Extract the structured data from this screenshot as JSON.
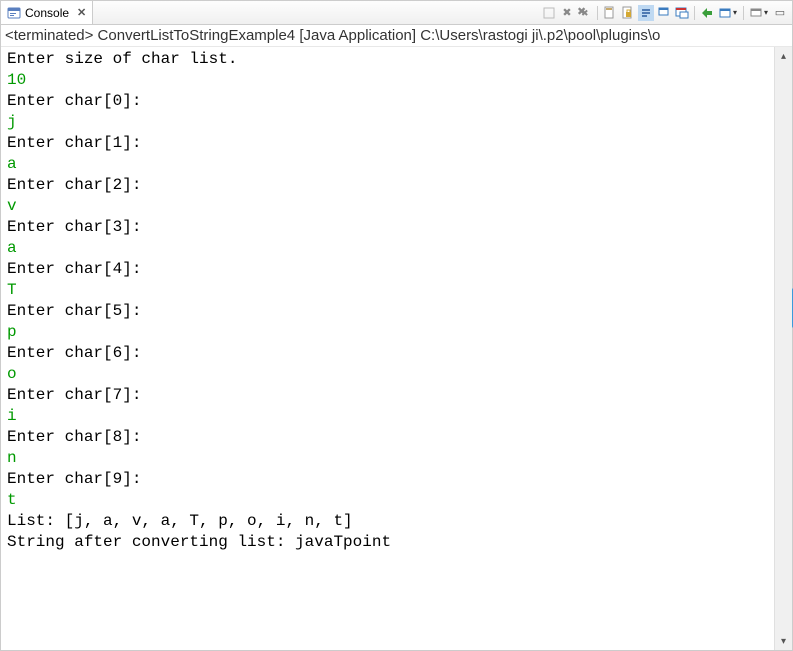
{
  "tab": {
    "title": "Console",
    "close_glyph": "✕"
  },
  "toolbar": {
    "blank": "",
    "x_gray": "✖",
    "xx_gray": "✖",
    "doc": "",
    "lock": "",
    "scroll": "",
    "word": "",
    "page": "",
    "green_right": "",
    "console2": "",
    "dash": "—",
    "pin": "",
    "menu": "▾",
    "max": "▭"
  },
  "status": {
    "text": "<terminated> ConvertListToStringExample4 [Java Application] C:\\Users\\rastogi ji\\.p2\\pool\\plugins\\o"
  },
  "console": {
    "lines": [
      {
        "cls": "out",
        "text": "Enter size of char list."
      },
      {
        "cls": "inp",
        "text": "10"
      },
      {
        "cls": "out",
        "text": "Enter char[0]:"
      },
      {
        "cls": "inp",
        "text": "j"
      },
      {
        "cls": "out",
        "text": "Enter char[1]:"
      },
      {
        "cls": "inp",
        "text": "a"
      },
      {
        "cls": "out",
        "text": "Enter char[2]:"
      },
      {
        "cls": "inp",
        "text": "v"
      },
      {
        "cls": "out",
        "text": "Enter char[3]:"
      },
      {
        "cls": "inp",
        "text": "a"
      },
      {
        "cls": "out",
        "text": "Enter char[4]:"
      },
      {
        "cls": "inp",
        "text": "T"
      },
      {
        "cls": "out",
        "text": "Enter char[5]:"
      },
      {
        "cls": "inp",
        "text": "p"
      },
      {
        "cls": "out",
        "text": "Enter char[6]:"
      },
      {
        "cls": "inp",
        "text": "o"
      },
      {
        "cls": "out",
        "text": "Enter char[7]:"
      },
      {
        "cls": "inp",
        "text": "i"
      },
      {
        "cls": "out",
        "text": "Enter char[8]:"
      },
      {
        "cls": "inp",
        "text": "n"
      },
      {
        "cls": "out",
        "text": "Enter char[9]:"
      },
      {
        "cls": "inp",
        "text": "t"
      },
      {
        "cls": "out",
        "text": "List: [j, a, v, a, T, p, o, i, n, t]"
      },
      {
        "cls": "out",
        "text": "String after converting list: javaTpoint"
      }
    ]
  }
}
